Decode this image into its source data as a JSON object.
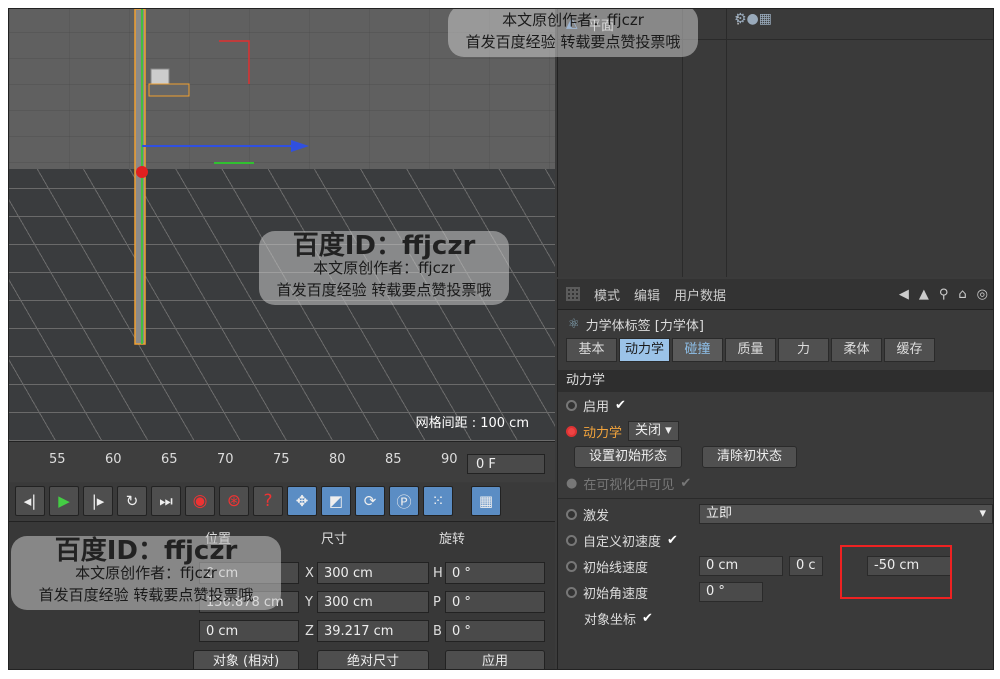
{
  "objman": {
    "title": "平面"
  },
  "viewport": {
    "grid_spacing": "网格间距 : 100 cm"
  },
  "timeline": {
    "ticks": [
      "55",
      "60",
      "65",
      "70",
      "75",
      "80",
      "85",
      "90"
    ],
    "frame": "0 F"
  },
  "props": {
    "menu": [
      "模式",
      "编辑",
      "用户数据"
    ],
    "tag_title": "力学体标签 [力学体]",
    "tabs": [
      "基本",
      "动力学",
      "碰撞",
      "质量",
      "力",
      "柔体",
      "缓存"
    ],
    "section": "动力学",
    "enable_label": "启用",
    "dynamics_label": "动力学",
    "dynamics_value": "关闭",
    "set_initial": "设置初始形态",
    "clear_initial": "清除初状态",
    "viewport_visible": "在可视化中可见",
    "trigger_label": "激发",
    "trigger_value": "立即",
    "custom_velocity": "自定义初速度",
    "init_linear": "初始线速度",
    "init_linear_x": "0 cm",
    "init_linear_y": "0 c",
    "init_linear_z": "-50 cm",
    "init_angular": "初始角速度",
    "init_angular_x": "0 °",
    "object_coords": "对象坐标"
  },
  "coords": {
    "headers": [
      "位置",
      "尺寸",
      "旋转"
    ],
    "rows": [
      {
        "axis": "X",
        "pos": "0 cm",
        "size": "300 cm",
        "rot_axis": "H",
        "rot": "0 °"
      },
      {
        "axis": "Y",
        "pos": "150.878 cm",
        "size": "300 cm",
        "rot_axis": "P",
        "rot": "0 °"
      },
      {
        "axis": "Z",
        "pos": "0 cm",
        "size": "39.217 cm",
        "rot_axis": "B",
        "rot": "0 °"
      }
    ],
    "mode_dd": "对象 (相对)",
    "size_dd": "绝对尺寸",
    "apply": "应用"
  },
  "watermarks": {
    "id": "百度ID：ffjczr",
    "line1": "本文原创作者：ffjczr",
    "line2": "首发百度经验 转载要点赞投票哦"
  }
}
